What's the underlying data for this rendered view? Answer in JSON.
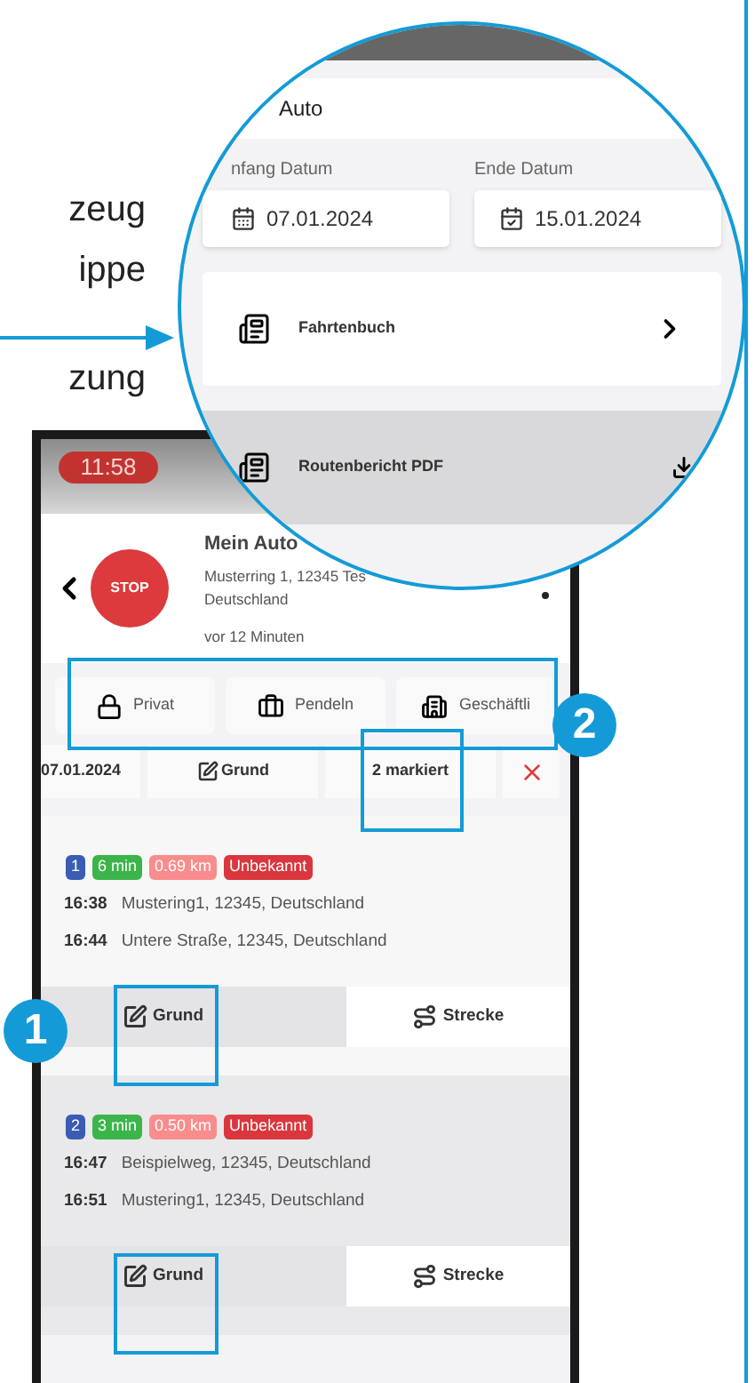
{
  "caption_fragments": [
    "zeug",
    "ippe",
    "zung"
  ],
  "magnifier": {
    "vehicle": "Auto",
    "start_label": "nfang Datum",
    "start_date": "07.01.2024",
    "end_label": "Ende Datum",
    "end_date": "15.01.2024",
    "menu": [
      {
        "label": "Fahrtenbuch",
        "kind": "link"
      },
      {
        "label": "Routenbericht PDF",
        "kind": "download"
      }
    ]
  },
  "phone": {
    "time": "11:58",
    "stop": "STOP",
    "vehicle": "Mein Auto",
    "address": [
      "Musterring 1, 12345 Tes",
      "Deutschland"
    ],
    "updated": "vor 12 Minuten",
    "categories": [
      {
        "label": "Privat",
        "kind": "lock"
      },
      {
        "label": "Pendeln",
        "kind": "briefcase"
      },
      {
        "label": "Geschäftli",
        "kind": "building"
      }
    ],
    "filters": {
      "date": "07.01.2024",
      "reason": "Grund",
      "marked": "2 markiert"
    },
    "trips": [
      {
        "number": "1",
        "duration": "6 min",
        "distance": "0.69 km",
        "status": "Unbekannt",
        "selected": false,
        "stops": [
          {
            "time": "16:38",
            "place": "Mustering1, 12345, Deutschland"
          },
          {
            "time": "16:44",
            "place": "Untere Straße, 12345, Deutschland"
          }
        ],
        "actions": [
          "Grund",
          "Strecke"
        ]
      },
      {
        "number": "2",
        "duration": "3 min",
        "distance": "0.50 km",
        "status": "Unbekannt",
        "selected": true,
        "stops": [
          {
            "time": "16:47",
            "place": "Beispielweg, 12345, Deutschland"
          },
          {
            "time": "16:51",
            "place": "Mustering1, 12345, Deutschland"
          }
        ],
        "actions": [
          "Grund",
          "Strecke"
        ]
      }
    ]
  },
  "callouts": [
    "1",
    "2"
  ]
}
